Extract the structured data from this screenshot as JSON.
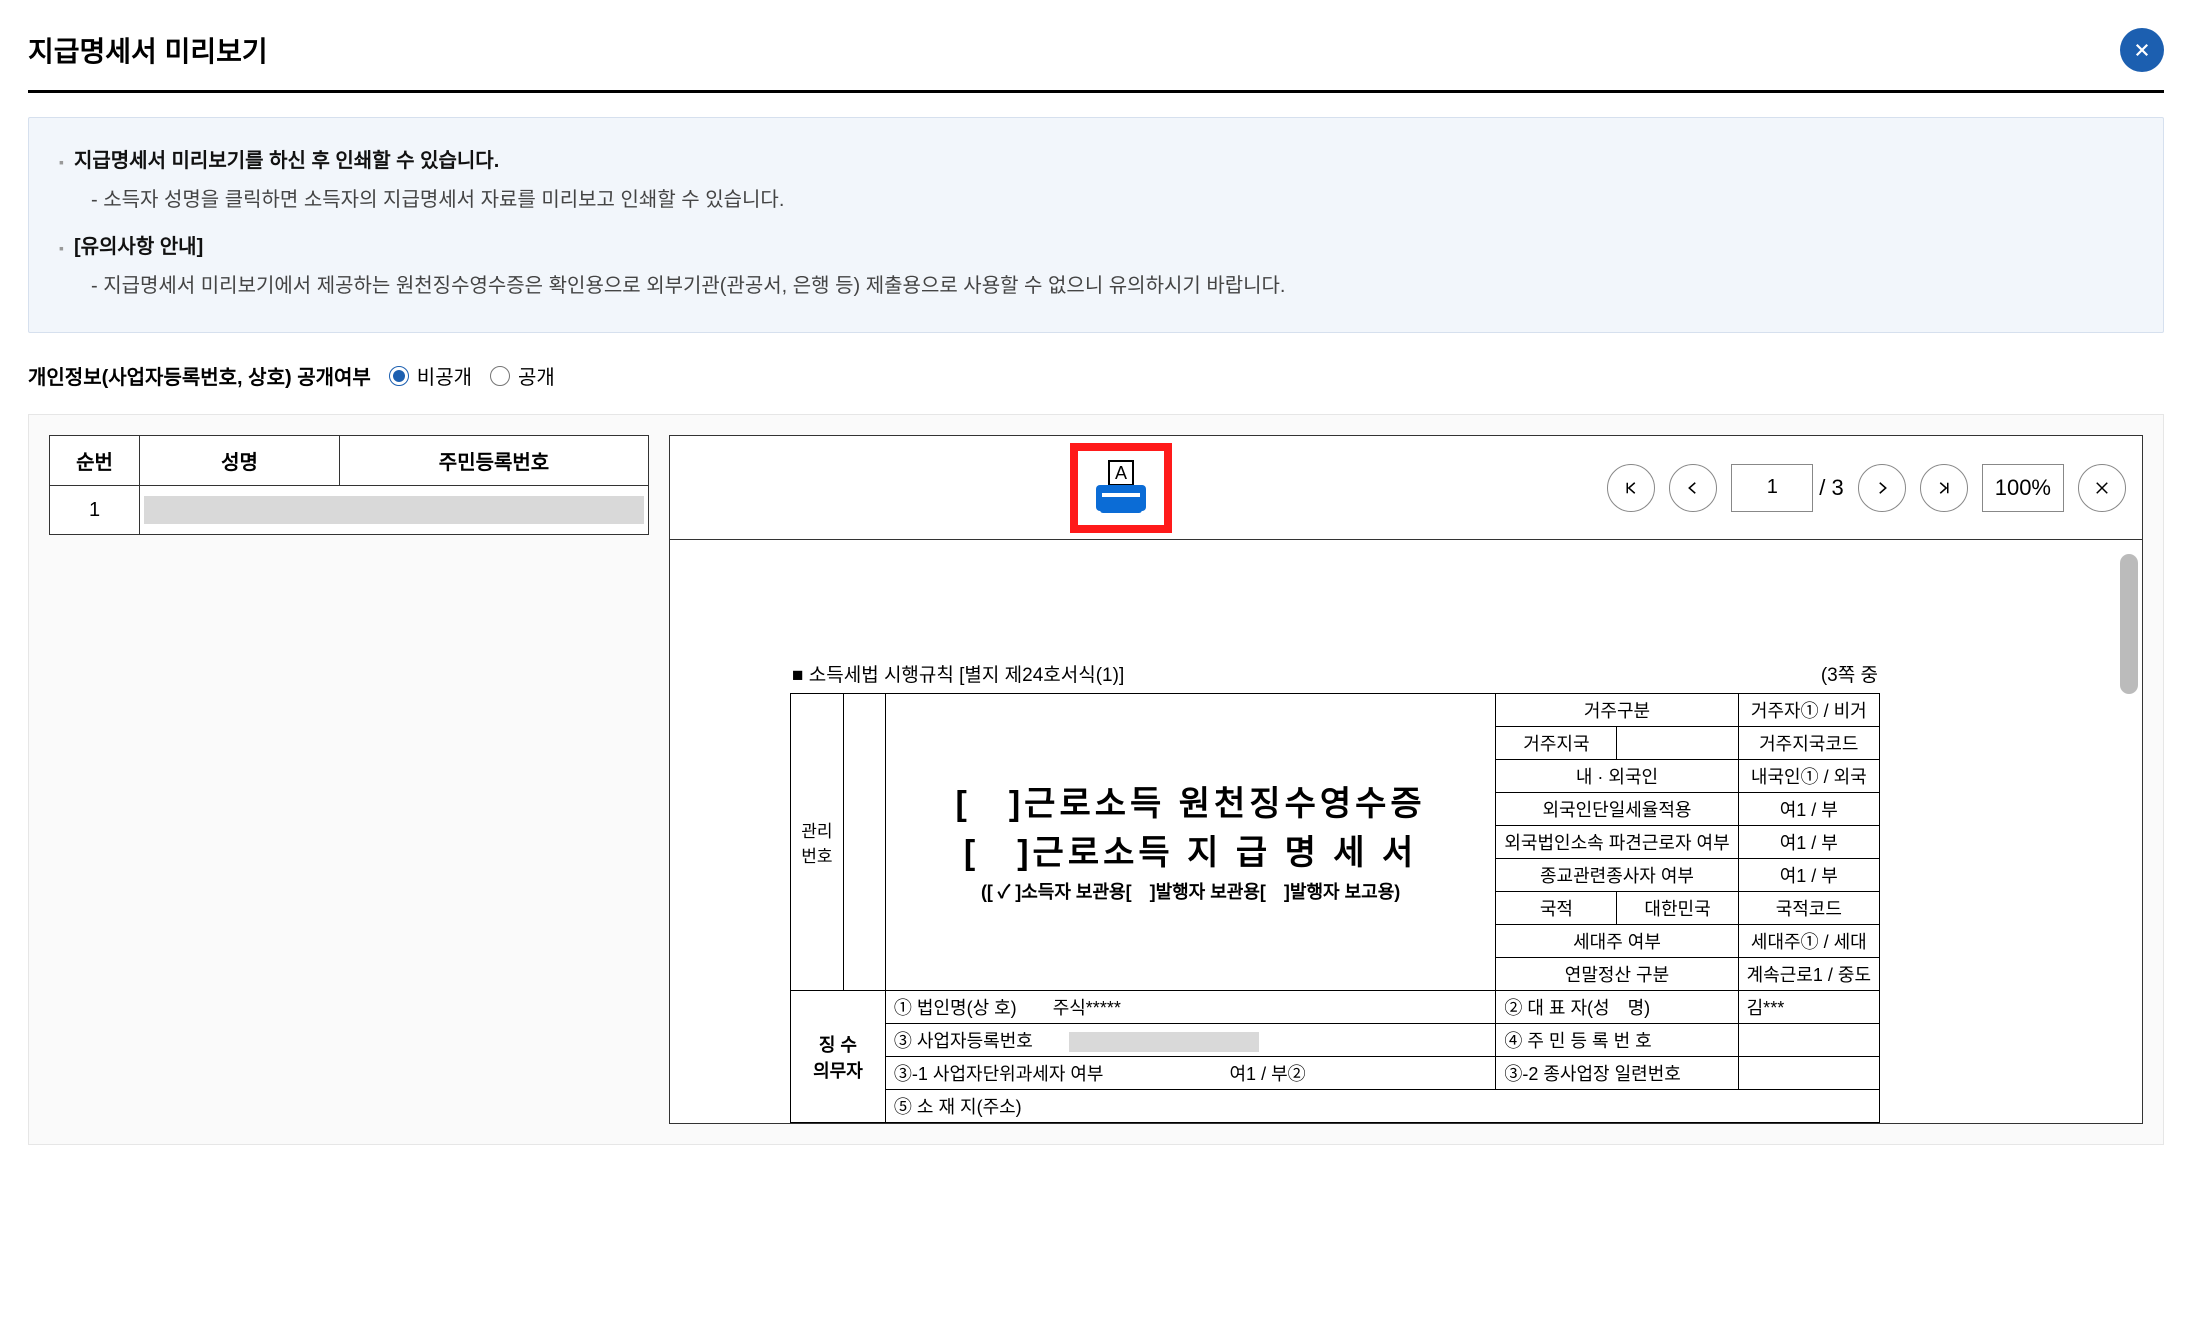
{
  "header": {
    "title": "지급명세서 미리보기"
  },
  "info": {
    "line1": "지급명세서 미리보기를 하신 후 인쇄할 수 있습니다.",
    "line1a": "- 소득자 성명을 클릭하면 소득자의 지급명세서 자료를 미리보고 인쇄할 수 있습니다.",
    "line2": "[유의사항 안내]",
    "line2a": "- 지급명세서 미리보기에서 제공하는 원천징수영수증은 확인용으로 외부기관(관공서, 은행 등) 제출용으로 사용할 수 없으니 유의하시기 바랍니다."
  },
  "disclosure": {
    "label": "개인정보(사업자등록번호, 상호) 공개여부",
    "opt_private": "비공개",
    "opt_public": "공개"
  },
  "list": {
    "col1": "순번",
    "col2": "성명",
    "col3": "주민등록번호",
    "row1_no": "1"
  },
  "viewer": {
    "page_current": "1",
    "page_total": "/ 3",
    "zoom": "100%"
  },
  "doc": {
    "form_ref": "■ 소득세법 시행규칙 [별지 제24호서식(1)]",
    "page_info": "(3쪽 중",
    "mgr_label1": "관리",
    "mgr_label2": "번호",
    "title1": "[　]근로소득 원천징수영수증",
    "title2": "[　]근로소득 지 급 명 세 서",
    "subtitle": "([ ✓ ]소득자 보관용[　]발행자 보관용[　]발행자 보고용)",
    "meta": {
      "r1a": "거주구분",
      "r1b": "거주자① / 비거",
      "r2a": "거주지국",
      "r2b": "거주지국코드",
      "r3a": "내 · 외국인",
      "r3b": "내국인① / 외국",
      "r4a": "외국인단일세율적용",
      "r4b": "여1 / 부",
      "r5a": "외국법인소속 파견근로자 여부",
      "r5b": "여1 / 부",
      "r6a": "종교관련종사자 여부",
      "r6b": "여1 / 부",
      "r7a": "국적",
      "r7a2": "대한민국",
      "r7b": "국적코드",
      "r8a": "세대주 여부",
      "r8b": "세대주① / 세대",
      "r9a": "연말정산 구분",
      "r9b": "계속근로1 / 중도"
    },
    "payer_label": "징 수\n의무자",
    "p1a": "① 법인명(상 호)",
    "p1b": "주식*****",
    "p2a": "② 대 표 자(성　명)",
    "p2b": "김***",
    "p3a": "③ 사업자등록번호",
    "p4a": "④ 주 민 등 록 번 호",
    "p5a": "③-1 사업자단위과세자 여부",
    "p5b": "여1 / 부②",
    "p6a": "③-2 종사업장 일련번호",
    "p7a": "⑤ 소 재 지(주소)"
  }
}
